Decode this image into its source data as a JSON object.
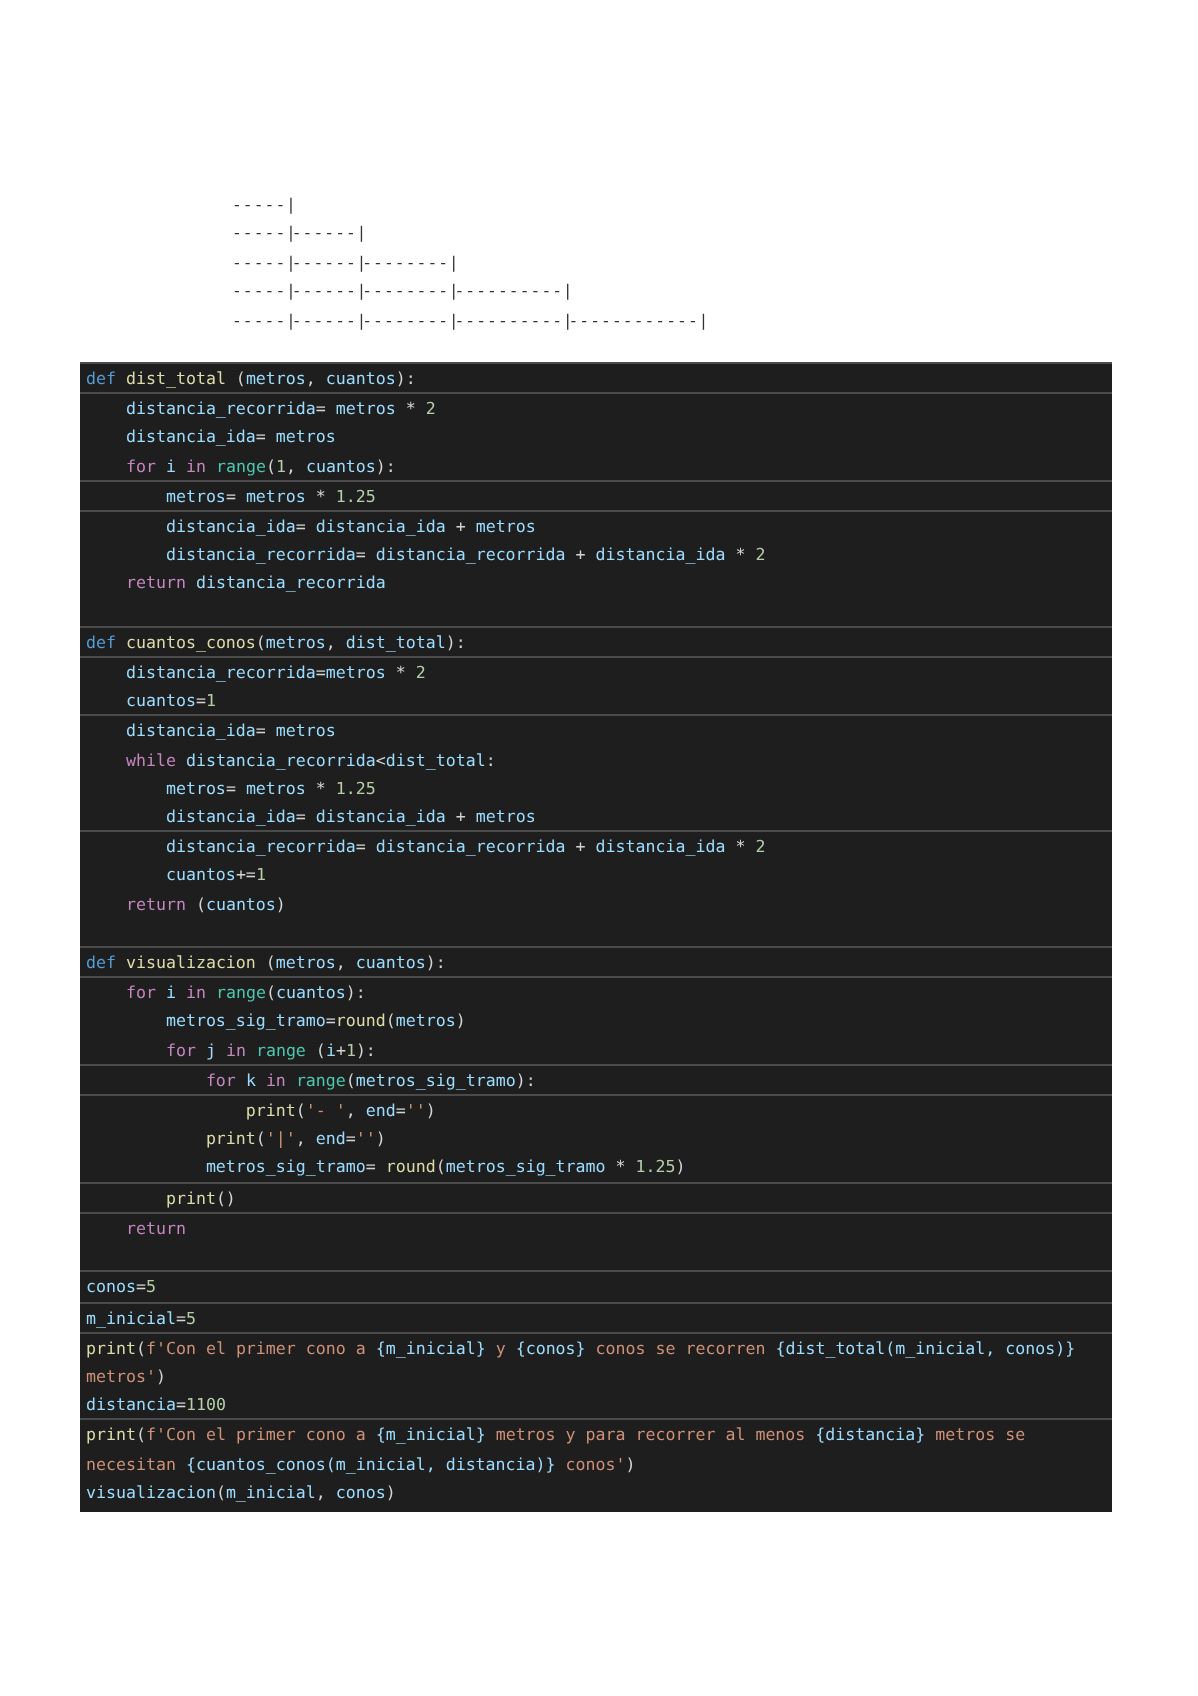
{
  "output_lines": [
    "- - - - - |",
    "- - - - - |- - - - - - |",
    "- - - - - |- - - - - - |- - - - - - - - |",
    "- - - - - |- - - - - - |- - - - - - - - |- - - - - - - - - - |",
    "- - - - - |- - - - - - |- - - - - - - - |- - - - - - - - - - |- - - - - - - - - - - - |"
  ],
  "code_sections": [
    [
      [
        [
          {
            "kind": "kw",
            "text": "def "
          },
          {
            "kind": "fn",
            "text": "dist_total"
          },
          {
            "kind": "op",
            "text": " ("
          },
          {
            "kind": "id",
            "text": "metros"
          },
          {
            "kind": "op",
            "text": ", "
          },
          {
            "kind": "id",
            "text": "cuantos"
          },
          {
            "kind": "op",
            "text": "):"
          }
        ]
      ],
      [
        [
          {
            "kind": "id",
            "text": "    distancia_recorrida"
          },
          {
            "kind": "op",
            "text": "= "
          },
          {
            "kind": "id",
            "text": "metros"
          },
          {
            "kind": "op",
            "text": " * "
          },
          {
            "kind": "num",
            "text": "2"
          }
        ],
        [
          {
            "kind": "id",
            "text": "    distancia_ida"
          },
          {
            "kind": "op",
            "text": "= "
          },
          {
            "kind": "id",
            "text": "metros"
          }
        ],
        [
          {
            "kind": "ctl",
            "text": "    for "
          },
          {
            "kind": "id",
            "text": "i "
          },
          {
            "kind": "ctl",
            "text": "in "
          },
          {
            "kind": "bi",
            "text": "range"
          },
          {
            "kind": "op",
            "text": "("
          },
          {
            "kind": "num",
            "text": "1"
          },
          {
            "kind": "op",
            "text": ", "
          },
          {
            "kind": "id",
            "text": "cuantos"
          },
          {
            "kind": "op",
            "text": "):"
          }
        ]
      ],
      [
        [
          {
            "kind": "id",
            "text": "        metros"
          },
          {
            "kind": "op",
            "text": "= "
          },
          {
            "kind": "id",
            "text": "metros"
          },
          {
            "kind": "op",
            "text": " * "
          },
          {
            "kind": "num",
            "text": "1.25"
          }
        ]
      ],
      [
        [
          {
            "kind": "id",
            "text": "        distancia_ida"
          },
          {
            "kind": "op",
            "text": "= "
          },
          {
            "kind": "id",
            "text": "distancia_ida"
          },
          {
            "kind": "op",
            "text": " + "
          },
          {
            "kind": "id",
            "text": "metros"
          }
        ],
        [
          {
            "kind": "id",
            "text": "        distancia_recorrida"
          },
          {
            "kind": "op",
            "text": "= "
          },
          {
            "kind": "id",
            "text": "distancia_recorrida"
          },
          {
            "kind": "op",
            "text": " + "
          },
          {
            "kind": "id",
            "text": "distancia_ida"
          },
          {
            "kind": "op",
            "text": " * "
          },
          {
            "kind": "num",
            "text": "2"
          }
        ],
        [
          {
            "kind": "ctl",
            "text": "    return "
          },
          {
            "kind": "id",
            "text": "distancia_recorrida"
          }
        ]
      ]
    ],
    [
      [
        [
          {
            "kind": "kw",
            "text": "def "
          },
          {
            "kind": "fn",
            "text": "cuantos_conos"
          },
          {
            "kind": "op",
            "text": "("
          },
          {
            "kind": "id",
            "text": "metros"
          },
          {
            "kind": "op",
            "text": ", "
          },
          {
            "kind": "id",
            "text": "dist_total"
          },
          {
            "kind": "op",
            "text": "):"
          }
        ]
      ],
      [
        [
          {
            "kind": "id",
            "text": "    distancia_recorrida"
          },
          {
            "kind": "op",
            "text": "="
          },
          {
            "kind": "id",
            "text": "metros"
          },
          {
            "kind": "op",
            "text": " * "
          },
          {
            "kind": "num",
            "text": "2"
          }
        ],
        [
          {
            "kind": "id",
            "text": "    cuantos"
          },
          {
            "kind": "op",
            "text": "="
          },
          {
            "kind": "num",
            "text": "1"
          }
        ]
      ],
      [
        [
          {
            "kind": "id",
            "text": "    distancia_ida"
          },
          {
            "kind": "op",
            "text": "= "
          },
          {
            "kind": "id",
            "text": "metros"
          }
        ],
        [
          {
            "kind": "ctl",
            "text": "    while "
          },
          {
            "kind": "id",
            "text": "distancia_recorrida"
          },
          {
            "kind": "op",
            "text": "<"
          },
          {
            "kind": "id",
            "text": "dist_total"
          },
          {
            "kind": "op",
            "text": ":"
          }
        ],
        [
          {
            "kind": "id",
            "text": "        metros"
          },
          {
            "kind": "op",
            "text": "= "
          },
          {
            "kind": "id",
            "text": "metros"
          },
          {
            "kind": "op",
            "text": " * "
          },
          {
            "kind": "num",
            "text": "1.25"
          }
        ],
        [
          {
            "kind": "id",
            "text": "        distancia_ida"
          },
          {
            "kind": "op",
            "text": "= "
          },
          {
            "kind": "id",
            "text": "distancia_ida"
          },
          {
            "kind": "op",
            "text": " + "
          },
          {
            "kind": "id",
            "text": "metros"
          }
        ]
      ],
      [
        [
          {
            "kind": "id",
            "text": "        distancia_recorrida"
          },
          {
            "kind": "op",
            "text": "= "
          },
          {
            "kind": "id",
            "text": "distancia_recorrida"
          },
          {
            "kind": "op",
            "text": " + "
          },
          {
            "kind": "id",
            "text": "distancia_ida"
          },
          {
            "kind": "op",
            "text": " * "
          },
          {
            "kind": "num",
            "text": "2"
          }
        ],
        [
          {
            "kind": "id",
            "text": "        cuantos"
          },
          {
            "kind": "op",
            "text": "+="
          },
          {
            "kind": "num",
            "text": "1"
          }
        ],
        [
          {
            "kind": "ctl",
            "text": "    return "
          },
          {
            "kind": "op",
            "text": "("
          },
          {
            "kind": "id",
            "text": "cuantos"
          },
          {
            "kind": "op",
            "text": ")"
          }
        ]
      ]
    ],
    [
      [
        [
          {
            "kind": "kw",
            "text": "def "
          },
          {
            "kind": "fn",
            "text": "visualizacion"
          },
          {
            "kind": "op",
            "text": " ("
          },
          {
            "kind": "id",
            "text": "metros"
          },
          {
            "kind": "op",
            "text": ", "
          },
          {
            "kind": "id",
            "text": "cuantos"
          },
          {
            "kind": "op",
            "text": "):"
          }
        ]
      ],
      [
        [
          {
            "kind": "ctl",
            "text": "    for "
          },
          {
            "kind": "id",
            "text": "i "
          },
          {
            "kind": "ctl",
            "text": "in "
          },
          {
            "kind": "bi",
            "text": "range"
          },
          {
            "kind": "op",
            "text": "("
          },
          {
            "kind": "id",
            "text": "cuantos"
          },
          {
            "kind": "op",
            "text": "):"
          }
        ],
        [
          {
            "kind": "id",
            "text": "        metros_sig_tramo"
          },
          {
            "kind": "op",
            "text": "="
          },
          {
            "kind": "fn",
            "text": "round"
          },
          {
            "kind": "op",
            "text": "("
          },
          {
            "kind": "id",
            "text": "metros"
          },
          {
            "kind": "op",
            "text": ")"
          }
        ],
        [
          {
            "kind": "ctl",
            "text": "        for "
          },
          {
            "kind": "id",
            "text": "j "
          },
          {
            "kind": "ctl",
            "text": "in "
          },
          {
            "kind": "bi",
            "text": "range"
          },
          {
            "kind": "op",
            "text": " ("
          },
          {
            "kind": "id",
            "text": "i"
          },
          {
            "kind": "op",
            "text": "+"
          },
          {
            "kind": "num",
            "text": "1"
          },
          {
            "kind": "op",
            "text": "):"
          }
        ]
      ],
      [
        [
          {
            "kind": "ctl",
            "text": "            for "
          },
          {
            "kind": "id",
            "text": "k "
          },
          {
            "kind": "ctl",
            "text": "in "
          },
          {
            "kind": "bi",
            "text": "range"
          },
          {
            "kind": "op",
            "text": "("
          },
          {
            "kind": "id",
            "text": "metros_sig_tramo"
          },
          {
            "kind": "op",
            "text": "):"
          }
        ]
      ],
      [
        [
          {
            "kind": "fn",
            "text": "                print"
          },
          {
            "kind": "op",
            "text": "("
          },
          {
            "kind": "str",
            "text": "'- '"
          },
          {
            "kind": "op",
            "text": ", "
          },
          {
            "kind": "id",
            "text": "end"
          },
          {
            "kind": "op",
            "text": "="
          },
          {
            "kind": "str",
            "text": "''"
          },
          {
            "kind": "op",
            "text": ")"
          }
        ],
        [
          {
            "kind": "fn",
            "text": "            print"
          },
          {
            "kind": "op",
            "text": "("
          },
          {
            "kind": "str",
            "text": "'|'"
          },
          {
            "kind": "op",
            "text": ", "
          },
          {
            "kind": "id",
            "text": "end"
          },
          {
            "kind": "op",
            "text": "="
          },
          {
            "kind": "str",
            "text": "''"
          },
          {
            "kind": "op",
            "text": ")"
          }
        ],
        [
          {
            "kind": "id",
            "text": "            metros_sig_tramo"
          },
          {
            "kind": "op",
            "text": "= "
          },
          {
            "kind": "fn",
            "text": "round"
          },
          {
            "kind": "op",
            "text": "("
          },
          {
            "kind": "id",
            "text": "metros_sig_tramo"
          },
          {
            "kind": "op",
            "text": " * "
          },
          {
            "kind": "num",
            "text": "1.25"
          },
          {
            "kind": "op",
            "text": ")"
          }
        ]
      ],
      [
        [
          {
            "kind": "fn",
            "text": "        print"
          },
          {
            "kind": "op",
            "text": "()"
          }
        ]
      ],
      [
        [
          {
            "kind": "ctl",
            "text": "    return"
          }
        ]
      ]
    ],
    [
      [
        [
          {
            "kind": "id",
            "text": "conos"
          },
          {
            "kind": "op",
            "text": "="
          },
          {
            "kind": "num",
            "text": "5"
          }
        ]
      ],
      [
        [
          {
            "kind": "id",
            "text": "m_inicial"
          },
          {
            "kind": "op",
            "text": "="
          },
          {
            "kind": "num",
            "text": "5"
          }
        ]
      ],
      [
        [
          {
            "kind": "fn",
            "text": "print"
          },
          {
            "kind": "op",
            "text": "("
          },
          {
            "kind": "str",
            "text": "f'Con el primer cono a "
          },
          {
            "kind": "id",
            "text": "{m_inicial}"
          },
          {
            "kind": "str",
            "text": " y "
          },
          {
            "kind": "id",
            "text": "{conos}"
          },
          {
            "kind": "str",
            "text": " conos se recorren "
          },
          {
            "kind": "id",
            "text": "{dist_total(m_inicial, conos)}"
          }
        ],
        [
          {
            "kind": "str",
            "text": "metros'"
          },
          {
            "kind": "op",
            "text": ")"
          }
        ],
        [
          {
            "kind": "id",
            "text": "distancia"
          },
          {
            "kind": "op",
            "text": "="
          },
          {
            "kind": "num",
            "text": "1100"
          }
        ]
      ],
      [
        [
          {
            "kind": "fn",
            "text": "print"
          },
          {
            "kind": "op",
            "text": "("
          },
          {
            "kind": "str",
            "text": "f'Con el primer cono a "
          },
          {
            "kind": "id",
            "text": "{m_inicial}"
          },
          {
            "kind": "str",
            "text": " metros y para recorrer al menos "
          },
          {
            "kind": "id",
            "text": "{distancia}"
          },
          {
            "kind": "str",
            "text": " metros se"
          }
        ],
        [
          {
            "kind": "str",
            "text": "necesitan "
          },
          {
            "kind": "id",
            "text": "{cuantos_conos(m_inicial, distancia)}"
          },
          {
            "kind": "str",
            "text": " conos'"
          },
          {
            "kind": "op",
            "text": ")"
          }
        ],
        [
          {
            "kind": "id",
            "text": "visualizacion"
          },
          {
            "kind": "op",
            "text": "("
          },
          {
            "kind": "id",
            "text": "m_inicial"
          },
          {
            "kind": "op",
            "text": ", "
          },
          {
            "kind": "id",
            "text": "conos"
          },
          {
            "kind": "op",
            "text": ")"
          }
        ]
      ]
    ]
  ]
}
